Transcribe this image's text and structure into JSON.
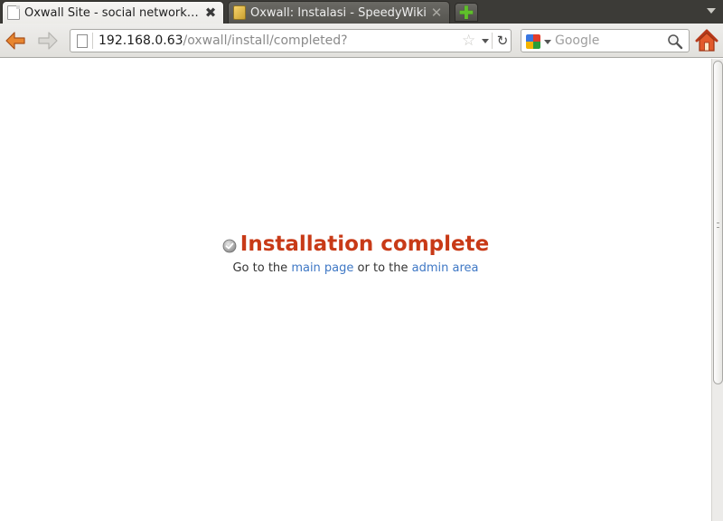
{
  "tabs": [
    {
      "title": "Oxwall Site - social network…",
      "active": true,
      "favicon": "page-icon",
      "close": "✖"
    },
    {
      "title": "Oxwall: Instalasi - SpeedyWiki",
      "active": false,
      "favicon": "wiki-icon",
      "close": "✕"
    }
  ],
  "new_tab": {
    "icon": "plus-icon",
    "glyph": "✚"
  },
  "toolbar": {
    "back_icon": "back-arrow-icon",
    "forward_icon": "forward-arrow-icon",
    "url_host": "192.168.0.63",
    "url_path": "/oxwall/install/completed?",
    "star_glyph": "☆",
    "reload_glyph": "↻",
    "search_placeholder": "Google",
    "home_icon": "home-icon"
  },
  "page": {
    "heading": "Installation complete",
    "sub_prefix": "Go to the",
    "link_main": "main page",
    "sub_middle": "or to the",
    "link_admin": "admin area"
  },
  "colors": {
    "heading": "#c83a17",
    "link": "#3f78c5",
    "tabstrip": "#3c3b37",
    "new_tab_plus": "#5fbf2a",
    "nav_arrow": "#e07a2d"
  }
}
